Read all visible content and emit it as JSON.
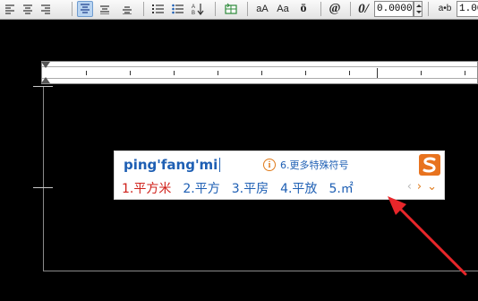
{
  "toolbar": {
    "align_icons": [
      "align-left-icon",
      "align-center-icon",
      "align-right-icon"
    ],
    "valign_icons": [
      "valign-top-icon",
      "valign-middle-icon",
      "valign-bottom-icon"
    ],
    "list_icons": [
      "numbered-list-icon",
      "bullet-list-icon",
      "sort-icon"
    ],
    "insert_icon": "table-insert-icon",
    "font_grow_label": "aA",
    "font_style_label": "Aa",
    "symbol_label": "ō",
    "at_label": "@",
    "oblique_label": "0/",
    "oblique_value": "0.0000",
    "tracking_label": "a•b",
    "tracking_value": "1.00"
  },
  "ime": {
    "composition": "ping'fang'mi",
    "hint_icon": "i",
    "hint": "6.更多特殊符号",
    "candidates": [
      "1.平方米",
      "2.平方",
      "3.平房",
      "4.平放",
      "5.㎡"
    ],
    "nav": {
      "prev": "‹",
      "next": "›",
      "more": "⌄"
    },
    "accent_color": "#e07a1a",
    "text_color": "#1e5fb4",
    "first_color": "#d0201a"
  },
  "annotation": {
    "arrow_color": "#e8262a"
  }
}
